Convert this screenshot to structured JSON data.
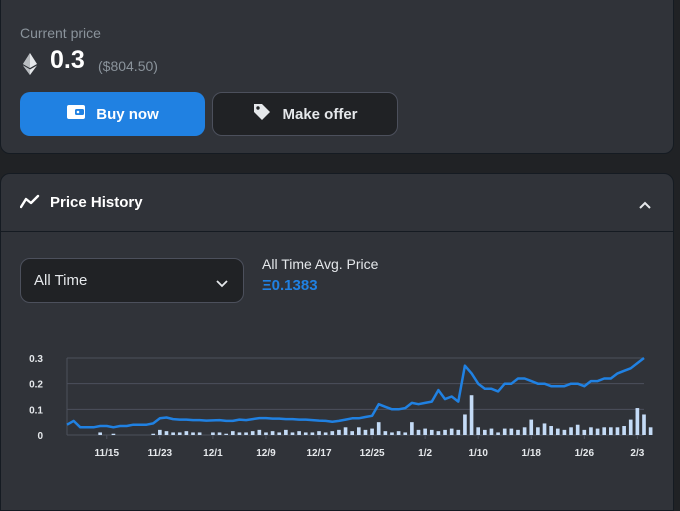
{
  "price_card": {
    "current_label": "Current price",
    "price": "0.3",
    "price_usd": "($804.50)",
    "buy_label": "Buy now",
    "offer_label": "Make offer",
    "icons": {
      "buy": "wallet-icon",
      "offer": "tag-icon",
      "currency": "ethereum-icon"
    }
  },
  "history": {
    "title": "Price History",
    "period_value": "All Time",
    "avg_label": "All Time Avg. Price",
    "avg_value": "Ξ0.1383",
    "icons": {
      "title": "trend-line-icon",
      "collapse": "chevron-up-icon",
      "select": "chevron-down-icon"
    }
  },
  "chart_data": {
    "type": "line",
    "x_tick_labels": [
      "11/15",
      "11/23",
      "12/1",
      "12/9",
      "12/17",
      "12/25",
      "1/2",
      "1/10",
      "1/18",
      "1/26",
      "2/3"
    ],
    "y_tick_labels": [
      "0.3",
      "0.2",
      "0.1",
      "0"
    ],
    "ylim": [
      0,
      0.3
    ],
    "xlim_days": [
      0,
      87
    ],
    "tick_start_day": 6,
    "tick_step_days": 8,
    "grid": true,
    "series": [
      {
        "kind": "line",
        "values": [
          0.04,
          0.055,
          0.03,
          0.03,
          0.03,
          0.035,
          0.035,
          0.03,
          0.035,
          0.035,
          0.04,
          0.04,
          0.04,
          0.045,
          0.065,
          0.068,
          0.062,
          0.06,
          0.06,
          0.058,
          0.058,
          0.056,
          0.057,
          0.058,
          0.055,
          0.055,
          0.06,
          0.058,
          0.062,
          0.066,
          0.066,
          0.064,
          0.064,
          0.062,
          0.062,
          0.06,
          0.06,
          0.058,
          0.056,
          0.055,
          0.052,
          0.055,
          0.06,
          0.065,
          0.065,
          0.07,
          0.075,
          0.12,
          0.11,
          0.1,
          0.1,
          0.105,
          0.125,
          0.12,
          0.125,
          0.13,
          0.175,
          0.14,
          0.15,
          0.13,
          0.27,
          0.24,
          0.2,
          0.18,
          0.18,
          0.17,
          0.2,
          0.2,
          0.22,
          0.22,
          0.21,
          0.2,
          0.2,
          0.19,
          0.19,
          0.19,
          0.2,
          0.2,
          0.19,
          0.21,
          0.21,
          0.22,
          0.22,
          0.24,
          0.25,
          0.26,
          0.28,
          0.3
        ]
      },
      {
        "kind": "volume",
        "values": [
          0,
          0,
          0,
          0,
          0,
          0.01,
          0,
          0.005,
          0,
          0,
          0,
          0,
          0,
          0.005,
          0.02,
          0.015,
          0.01,
          0.01,
          0.015,
          0.01,
          0.01,
          0,
          0.01,
          0.01,
          0.005,
          0.015,
          0.01,
          0.01,
          0.015,
          0.02,
          0.01,
          0.015,
          0.01,
          0.02,
          0.01,
          0.015,
          0.01,
          0.01,
          0.015,
          0.01,
          0.015,
          0.02,
          0.03,
          0.015,
          0.03,
          0.02,
          0.025,
          0.05,
          0.015,
          0.01,
          0.015,
          0.01,
          0.05,
          0.02,
          0.025,
          0.02,
          0.015,
          0.02,
          0.025,
          0.02,
          0.08,
          0.155,
          0.03,
          0.02,
          0.025,
          0.01,
          0.025,
          0.025,
          0.02,
          0.03,
          0.06,
          0.03,
          0.045,
          0.035,
          0.025,
          0.02,
          0.03,
          0.04,
          0.02,
          0.03,
          0.025,
          0.03,
          0.03,
          0.03,
          0.035,
          0.06,
          0.105,
          0.08,
          0.03
        ]
      }
    ],
    "colors": {
      "line": "#2081e2",
      "volume": "#c4dbf6",
      "grid": "#4c505c"
    }
  }
}
